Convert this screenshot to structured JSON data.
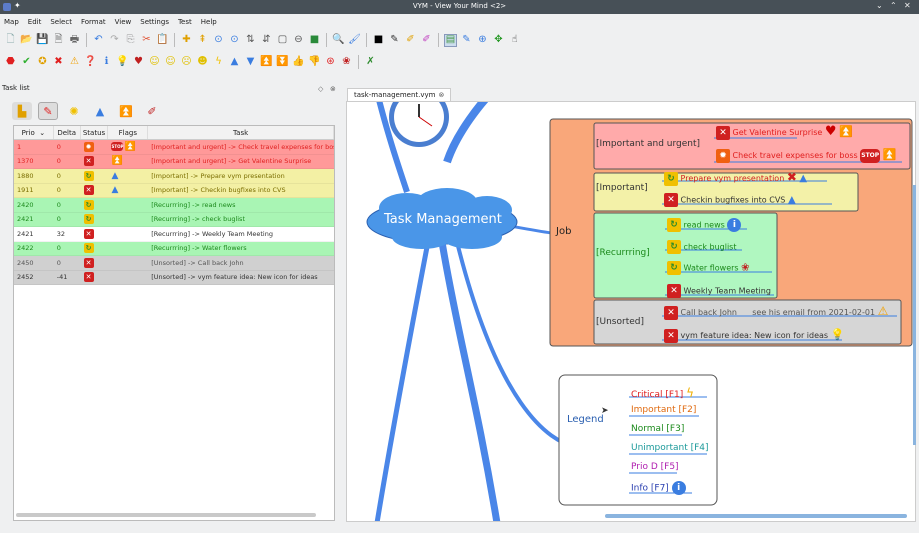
{
  "window": {
    "title": "VYM - View Your Mind <2>"
  },
  "menu": [
    "Map",
    "Edit",
    "Select",
    "Format",
    "View",
    "Settings",
    "Test",
    "Help"
  ],
  "toolbar1_icons": [
    "new-map-icon",
    "open-icon",
    "save-icon",
    "save-as-icon",
    "print-icon",
    "undo-icon",
    "redo-icon",
    "copy-icon",
    "cut-icon",
    "paste-icon",
    "add-branch-icon",
    "add-branch-above-icon",
    "move-up-icon",
    "move-down-icon",
    "sort-icon",
    "sort-back-icon",
    "frame-icon",
    "hide-icon",
    "color-icon",
    "find-icon",
    "format-brush-icon",
    "link-color-icon",
    "black-square-icon",
    "pen-icon",
    "xlink-icon",
    "relink-icon",
    "toggle-mode-icon",
    "edit-icon",
    "zoom-icon",
    "move-icon",
    "pan-icon"
  ],
  "toolbar2_icons": [
    "stop-icon",
    "check-icon",
    "smiley-icon",
    "cross-icon",
    "warning-icon",
    "question-icon",
    "info-icon",
    "lightbulb-icon",
    "heart-icon",
    "face-happy-icon",
    "face-neutral-icon",
    "face-sad-icon",
    "face-cool-icon",
    "lightning-icon",
    "arrow-up-icon",
    "arrow-down-icon",
    "double-up-icon",
    "double-down-icon",
    "thumb-up-icon",
    "thumb-down-icon",
    "lifebuoy-icon",
    "rose-icon",
    "clear-flag-icon"
  ],
  "tasklist": {
    "title": "Task list",
    "columns": [
      "Prio",
      "Delta",
      "Status",
      "Flags",
      "Task"
    ],
    "rows": [
      {
        "prio": "1",
        "delta": "0",
        "status": "sun",
        "flags": "stop,up2",
        "task": "[Important and urgent] -> Check travel expenses for boss",
        "bg": "#ff9999",
        "color": "#e02020"
      },
      {
        "prio": "1370",
        "delta": "0",
        "status": "cross",
        "flags": "up2",
        "task": "[Important and urgent] -> Get Valentine Surprise",
        "bg": "#ff9999",
        "color": "#e02020"
      },
      {
        "prio": "1880",
        "delta": "0",
        "status": "cycle",
        "flags": "up",
        "task": "[Important] -> Prepare vym presentation",
        "bg": "#f3f0a4",
        "color": "#7a6d00"
      },
      {
        "prio": "1911",
        "delta": "0",
        "status": "cross",
        "flags": "up",
        "task": "[Important] -> Checkin bugfixes into CVS",
        "bg": "#f3f0a4",
        "color": "#7a6d00"
      },
      {
        "prio": "2420",
        "delta": "0",
        "status": "cycle",
        "flags": "",
        "task": "[Recurrring] -> read news",
        "bg": "#a9f5b4",
        "color": "#1c8a1c"
      },
      {
        "prio": "2421",
        "delta": "0",
        "status": "cycle",
        "flags": "",
        "task": "[Recurrring] -> check buglist",
        "bg": "#a9f5b4",
        "color": "#1c8a1c"
      },
      {
        "prio": "2421",
        "delta": "32",
        "status": "cross",
        "flags": "",
        "task": "[Recurrring] -> Weekly Team Meeting",
        "bg": "#ffffff",
        "color": "#333333"
      },
      {
        "prio": "2422",
        "delta": "0",
        "status": "cycle",
        "flags": "",
        "task": "[Recurrring] -> Water flowers",
        "bg": "#a9f5b4",
        "color": "#1c8a1c"
      },
      {
        "prio": "2450",
        "delta": "0",
        "status": "cross",
        "flags": "",
        "task": "[Unsorted] -> Call back John",
        "bg": "#d0d0d0",
        "color": "#555555"
      },
      {
        "prio": "2452",
        "delta": "-41",
        "status": "cross",
        "flags": "",
        "task": "[Unsorted] -> vym feature idea: New icon for ideas",
        "bg": "#d0d0d0",
        "color": "#333333"
      }
    ]
  },
  "tab": {
    "label": "task-management.vym"
  },
  "map": {
    "root": "Task Management",
    "job": "Job",
    "branches": {
      "urgent": {
        "label": "[Important and urgent]",
        "items": [
          "Get Valentine Surprise",
          "Check travel expenses for boss"
        ]
      },
      "important": {
        "label": "[Important]",
        "items": [
          "Prepare vym presentation",
          "Checkin bugfixes into CVS"
        ]
      },
      "recurring": {
        "label": "[Recurrring]",
        "items": [
          "read news",
          "check buglist",
          "Water flowers",
          "Weekly Team Meeting"
        ]
      },
      "unsorted": {
        "label": "[Unsorted]",
        "items": [
          "Call back John",
          "see his email from 2021-02-01",
          "vym feature idea: New icon for ideas"
        ]
      }
    },
    "legend": {
      "label": "Legend",
      "items": [
        "Critical  [F1]",
        "Important  [F2]",
        "Normal [F3]",
        "Unimportant [F4]",
        "Prio D [F5]",
        "Info [F7]"
      ]
    }
  },
  "colors": {
    "urgent_bg": "#ffaaaa",
    "important_bg": "#f3f1a8",
    "recurring_bg": "#b0f7c0",
    "unsorted_bg": "#d6d6d6",
    "job_frame": "#f9a77a",
    "link_blue": "#3a7de0",
    "cloud": "#4a96e8"
  }
}
